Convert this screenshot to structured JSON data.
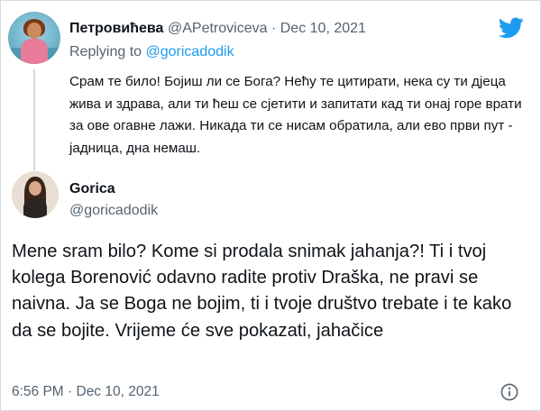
{
  "parent_tweet": {
    "display_name": "Петровићева",
    "handle": "@APetroviceva",
    "separator": "·",
    "date": "Dec 10, 2021",
    "replying_prefix": "Replying to",
    "replying_to": "@goricadodik",
    "text": "Срам те било! Бојиш ли се Бога? Нећу те цитирати, нека су ти дјеца жива и здрава, али ти ћеш се сјетити и запитати кад ти онај горе врати за ове огавне лажи. Никада ти се нисам обратила, али ево први пут - јадница, дна немаш."
  },
  "main_tweet": {
    "display_name": "Gorica",
    "handle": "@goricadodik",
    "text": "Mene sram bilo? Kome si prodala snimak jahanja?! Ti i tvoj kolega Borenović odavno radite protiv Draška, ne pravi se naivna. Ja se Boga ne bojim, ti i tvoje društvo trebate i te kako da se bojite. Vrijeme će sve pokazati, jahačice",
    "timestamp": "6:56 PM · Dec 10, 2021"
  },
  "icons": {
    "brand": "twitter-bird-icon",
    "info": "info-icon"
  },
  "colors": {
    "twitter_blue": "#1d9bf0",
    "secondary_text": "#536471",
    "primary_text": "#0f1419",
    "thread_line": "#cfd9de"
  }
}
